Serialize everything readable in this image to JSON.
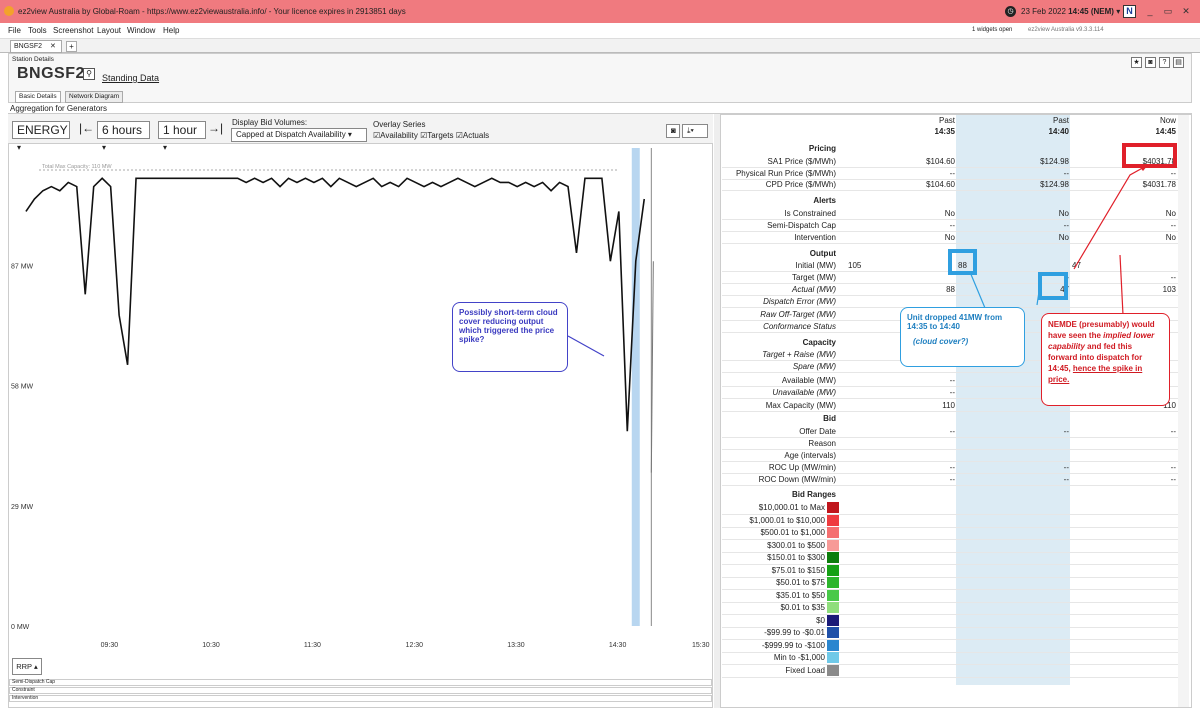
{
  "window": {
    "title": "ez2view Australia by Global-Roam - https://www.ez2viewaustralia.info/ - Your licence expires in 2913851 days",
    "date": "23 Feb 2022",
    "time": "14:45 (NEM)",
    "min_label": "_",
    "max_label": "▭",
    "close_label": "✕"
  },
  "menu": [
    "File",
    "Tools",
    "Screenshot",
    "Layout",
    "Window",
    "Help"
  ],
  "widgets_open": "1 widgets open",
  "version": "ez2view Australia v9.3.3.114",
  "doc_tab": "BNGSF2",
  "station": {
    "panel_label": "Station Details",
    "name": "BNGSF2",
    "standing_data": "Standing Data",
    "tabs": [
      "Basic Details",
      "Network Diagram"
    ]
  },
  "aggregation_title": "Aggregation for Generators",
  "toolbar": {
    "energy": "ENERGY",
    "range": "6 hours",
    "step": "1 hour",
    "bid_volumes_label": "Display Bid Volumes:",
    "bid_volumes_value": "Capped at Dispatch Availability",
    "overlay_label": "Overlay Series",
    "overlay": [
      "Availability",
      "Targets",
      "Actuals"
    ]
  },
  "chart_data": {
    "type": "line",
    "max_capacity_label": "Total Max Capacity: 110 MW",
    "y_ticks": [
      "0 MW",
      "29 MW",
      "58 MW",
      "87 MW"
    ],
    "x_ticks": [
      "09:30",
      "10:30",
      "11:30",
      "12:30",
      "13:30",
      "14:30",
      "15:30"
    ],
    "x_minutes": [
      520,
      525,
      530,
      535,
      540,
      545,
      550,
      555,
      560,
      565,
      570,
      575,
      580,
      585,
      590,
      595,
      600,
      605,
      610,
      615,
      620,
      625,
      630,
      635,
      640,
      645,
      650,
      655,
      660,
      665,
      670,
      675,
      680,
      685,
      690,
      695,
      700,
      705,
      710,
      715,
      720,
      725,
      730,
      735,
      740,
      745,
      750,
      755,
      760,
      765,
      770,
      775,
      780,
      785,
      790,
      795,
      800,
      805,
      810,
      815,
      820,
      825,
      830,
      835,
      840,
      845,
      850,
      855,
      860,
      865,
      870,
      875,
      880,
      885
    ],
    "y_mw": [
      100,
      103,
      105,
      106,
      105,
      107,
      106,
      80,
      106,
      108,
      106,
      75,
      63,
      108,
      108,
      108,
      108,
      108,
      108,
      108,
      108,
      108,
      108,
      108,
      108,
      108,
      107,
      108,
      107,
      108,
      106,
      108,
      107,
      108,
      107,
      108,
      106,
      108,
      107,
      106,
      107,
      108,
      106,
      107,
      106,
      108,
      107,
      106,
      107,
      106,
      107,
      108,
      107,
      106,
      107,
      108,
      107,
      107,
      106,
      107,
      106,
      107,
      105,
      107,
      106,
      90,
      108,
      108,
      108,
      88,
      100,
      47,
      88,
      103
    ],
    "ylim": [
      0,
      110
    ],
    "xlim": [
      510,
      925
    ]
  },
  "rrp_button": "RRP",
  "lanes": [
    "Semi-Dispatch Cap",
    "Constraint",
    "Intervention"
  ],
  "table": {
    "columns": [
      {
        "state": "Past",
        "time": "14:35"
      },
      {
        "state": "Past",
        "time": "14:40"
      },
      {
        "state": "Now",
        "time": "14:45"
      }
    ],
    "sections": {
      "pricing": "Pricing",
      "alerts": "Alerts",
      "output": "Output",
      "capacity": "Capacity",
      "bid": "Bid",
      "bid_ranges": "Bid Ranges"
    },
    "rows": {
      "sa1_price": {
        "label": "SA1 Price ($/MWh)",
        "v": [
          "$104.60",
          "$124.98",
          "$4031.78"
        ]
      },
      "phys_run": {
        "label": "Physical Run Price ($/MWh)",
        "v": [
          "--",
          "--",
          "--"
        ]
      },
      "cpd_price": {
        "label": "CPD Price ($/MWh)",
        "v": [
          "$104.60",
          "$124.98",
          "$4031.78"
        ]
      },
      "constrained": {
        "label": "Is Constrained",
        "v": [
          "No",
          "No",
          "No"
        ]
      },
      "semi_cap": {
        "label": "Semi-Dispatch Cap",
        "v": [
          "--",
          "--",
          "--"
        ]
      },
      "intervention": {
        "label": "Intervention",
        "v": [
          "No",
          "No",
          "No"
        ]
      },
      "initial": {
        "label": "Initial (MW)",
        "v": [
          "105",
          "88",
          "47"
        ]
      },
      "target": {
        "label": "Target (MW)",
        "v": [
          "",
          "--",
          "--"
        ]
      },
      "actual": {
        "label": "Actual (MW)",
        "v": [
          "88",
          "47",
          "103"
        ]
      },
      "dispatch_error": {
        "label": "Dispatch Error (MW)"
      },
      "raw_off": {
        "label": "Raw Off-Target (MW)"
      },
      "conformance": {
        "label": "Conformance Status"
      },
      "target_raise": {
        "label": "Target + Raise (MW)"
      },
      "spare": {
        "label": "Spare (MW)"
      },
      "available": {
        "label": "Available (MW)",
        "v": [
          "--",
          "",
          ""
        ]
      },
      "unavailable": {
        "label": "Unavailable (MW)",
        "v": [
          "--",
          "",
          ""
        ]
      },
      "max_capacity": {
        "label": "Max Capacity (MW)",
        "v": [
          "110",
          "",
          "110"
        ]
      },
      "offer_date": {
        "label": "Offer Date",
        "v": [
          "--",
          "--",
          "--"
        ]
      },
      "reason": {
        "label": "Reason"
      },
      "age": {
        "label": "Age (intervals)"
      },
      "roc_up": {
        "label": "ROC Up (MW/min)",
        "v": [
          "--",
          "--",
          "--"
        ]
      },
      "roc_down": {
        "label": "ROC Down (MW/min)",
        "v": [
          "--",
          "--",
          "--"
        ]
      }
    },
    "bid_ranges": [
      {
        "label": "$10,000.01 to Max",
        "color": "#c0161c"
      },
      {
        "label": "$1,000.01 to $10,000",
        "color": "#ef3b3f"
      },
      {
        "label": "$500.01 to $1,000",
        "color": "#f56f70"
      },
      {
        "label": "$300.01 to $500",
        "color": "#f79a97"
      },
      {
        "label": "$150.01 to $300",
        "color": "#0c7d0c"
      },
      {
        "label": "$75.01 to $150",
        "color": "#15a015"
      },
      {
        "label": "$50.01 to $75",
        "color": "#2cb52c"
      },
      {
        "label": "$35.01 to $50",
        "color": "#48c948"
      },
      {
        "label": "$0.01 to $35",
        "color": "#8fde7c"
      },
      {
        "label": "$0",
        "color": "#1a1a78"
      },
      {
        "label": "-$99.99 to -$0.01",
        "color": "#1f50a8"
      },
      {
        "label": "-$999.99 to -$100",
        "color": "#2a86cf"
      },
      {
        "label": "Min to -$1,000",
        "color": "#6fc9e8"
      },
      {
        "label": "Fixed Load",
        "color": "#8a8a8a"
      }
    ]
  },
  "annotations": {
    "cloud": "Possibly short-term cloud cover  reducing output which triggered the price spike?",
    "unit_dropped": "Unit dropped 41MW from 14:35 to 14:40",
    "cloud_q": "(cloud cover?)",
    "nemde_a": "NEMDE (presumably) would have seen the ",
    "nemde_b": "implied lower capability",
    "nemde_c": " and fed this forward into dispatch for 14:45, ",
    "nemde_d": "hence the spike in price."
  },
  "colors": {
    "titlebar": "#f07a7f",
    "highlight_col": "#dcebf4",
    "callout_blue": "#2f9fe0",
    "callout_red": "#e0202a",
    "callout_purple": "#4343c8"
  }
}
